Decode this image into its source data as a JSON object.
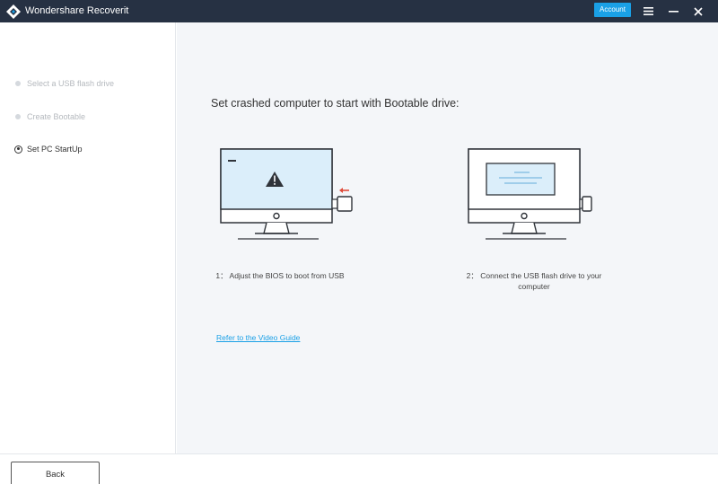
{
  "titlebar": {
    "app_title": "Wondershare Recoverit",
    "account_label": "Account",
    "icons": [
      "recoverit-logo",
      "menu-icon",
      "minimize-icon",
      "close-icon"
    ]
  },
  "sidebar": {
    "steps": [
      {
        "label": "Select a USB flash drive",
        "state": "inactive"
      },
      {
        "label": "Create Bootable",
        "state": "inactive"
      },
      {
        "label": "Set PC StartUp",
        "state": "active"
      }
    ]
  },
  "main": {
    "heading": "Set crashed computer to start with Bootable drive:",
    "step1_caption": "1： Adjust the BIOS to boot from USB",
    "step2_caption_line1": "2： Connect the USB flash drive to your",
    "step2_caption_line2": "computer",
    "video_guide_link": "Refer to the Video Guide"
  },
  "footer": {
    "back_label": "Back"
  },
  "colors": {
    "titlebar": "#263143",
    "accent": "#1aa0e6",
    "content_bg": "#f4f6f9",
    "illustration_screen": "#dbeefa",
    "illustration_stroke": "#30343a",
    "usb_arrow": "#e04b3a"
  }
}
